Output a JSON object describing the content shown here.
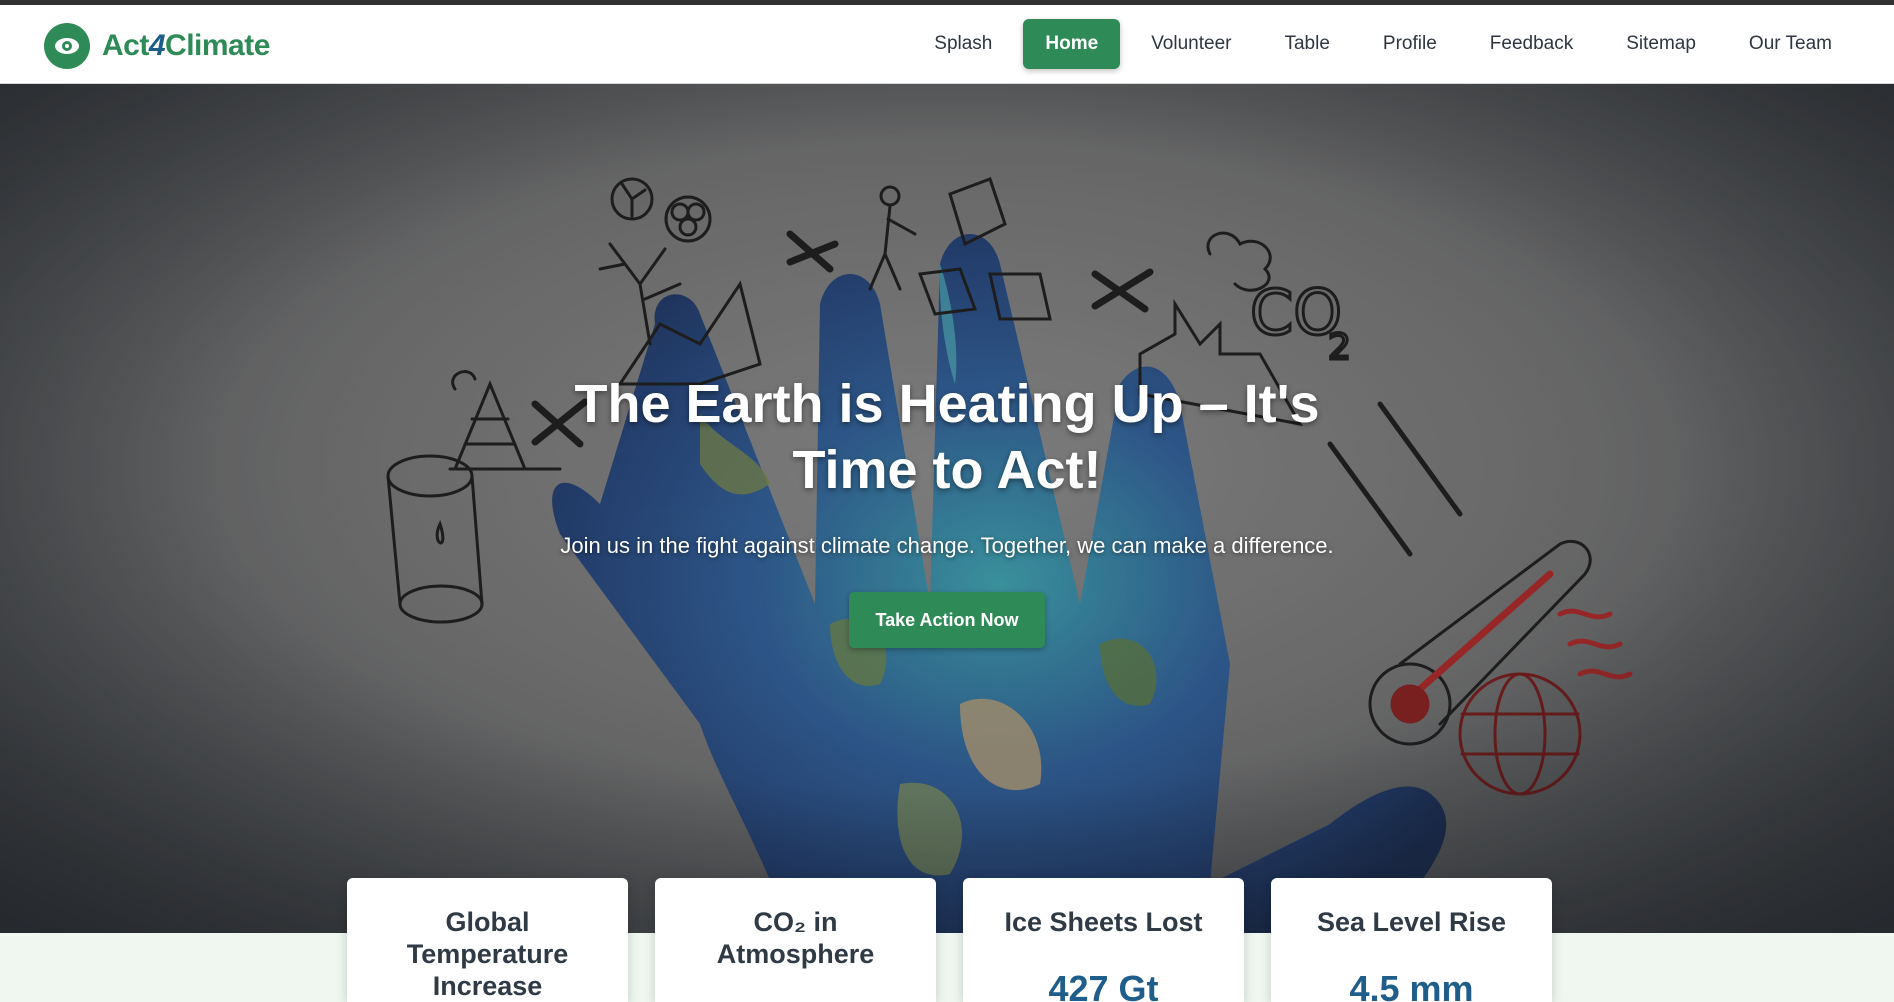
{
  "brand": {
    "name_pre": "Act",
    "name_four": "4",
    "name_post": "Climate",
    "logo_icon": "eye-leaf-icon"
  },
  "nav": {
    "items": [
      {
        "label": "Splash",
        "active": false
      },
      {
        "label": "Home",
        "active": true
      },
      {
        "label": "Volunteer",
        "active": false
      },
      {
        "label": "Table",
        "active": false
      },
      {
        "label": "Profile",
        "active": false
      },
      {
        "label": "Feedback",
        "active": false
      },
      {
        "label": "Sitemap",
        "active": false
      },
      {
        "label": "Our Team",
        "active": false
      }
    ]
  },
  "hero": {
    "title": "The Earth is Heating Up – It's Time to Act!",
    "subtitle": "Join us in the fight against climate change. Together, we can make a difference.",
    "cta_label": "Take Action Now",
    "background_icons": [
      "radiation-icon",
      "biohazard-icon",
      "dead-tree-icon",
      "lumberjack-icon",
      "tree-stump-icon",
      "co2-factory-icon",
      "oil-rig-icon",
      "oil-barrel-icon",
      "thermometer-icon",
      "globe-icon",
      "earth-hand-icon"
    ]
  },
  "stats": [
    {
      "title": "Global Temperature Increase",
      "value": ""
    },
    {
      "title": "CO₂ in Atmosphere",
      "value": ""
    },
    {
      "title": "Ice Sheets Lost",
      "value": "427 Gt"
    },
    {
      "title": "Sea Level Rise",
      "value": "4.5 mm"
    }
  ],
  "colors": {
    "accent": "#2e8b57",
    "stat_value": "#1f5d8a",
    "heading": "#2f3a45"
  }
}
